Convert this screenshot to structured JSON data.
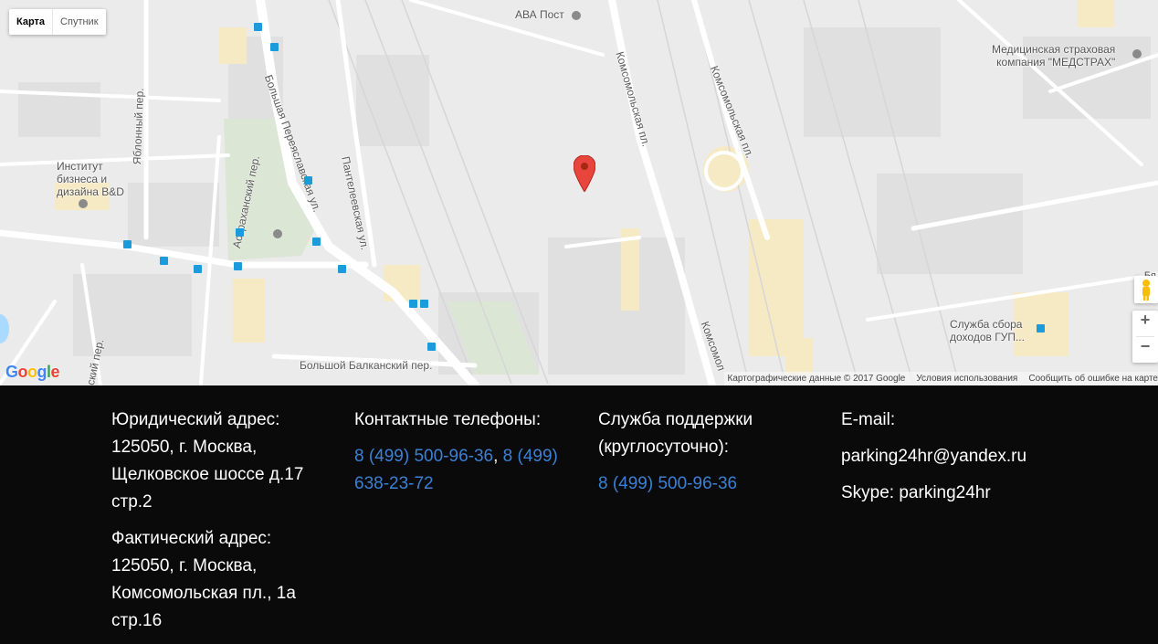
{
  "map": {
    "type_buttons": [
      "Карта",
      "Спутник"
    ],
    "labels": {
      "ava_post": "АВА Пост",
      "medstrakh": "Медицинская страховая\nкомпания \"МЕДСТРАХ\"",
      "institute": "Институт\nбизнеса и\nдизайна B&D",
      "yablonny": "Яблонный пер.",
      "astrakhansky": "Астраханский пер.",
      "bolshaya_pereslavskaya": "Большая Переяславская ул.",
      "panteleevskaya": "Пантелеевская ул.",
      "komsomolskaya1": "Комсомольская пл.",
      "komsomolskaya2": "Комсомольская пл.",
      "komsomol3": "Комсомол",
      "bolshoy_balkansky": "Большой Балканский пер.",
      "sluzhba_sbora": "Служба сбора\nдоходов ГУП...",
      "right_cut": "Бя",
      "left_cut": "ский пер."
    },
    "attribution": {
      "data": "Картографические данные © 2017 Google",
      "terms": "Условия использования",
      "report": "Сообщить об ошибке на карте"
    },
    "google_logo": "Google"
  },
  "footer": {
    "legal": {
      "title": "Юридический адрес:",
      "address": "125050, г. Москва, Щелковское шоссе д.17 стр.2"
    },
    "actual": {
      "title": "Фактический адрес:",
      "address": "125050, г. Москва, Комсомольская пл., 1а стр.16"
    },
    "phones": {
      "title": "Контактные телефоны:",
      "phone1": "8 (499) 500-96-36",
      "separator": ",",
      "phone2": "8 (499) 638-23-72"
    },
    "support": {
      "title": "Служба поддержки (круглосуточно):",
      "phone": "8 (499) 500-96-36"
    },
    "contacts": {
      "email_title": "E-mail:",
      "email": "parking24hr@yandex.ru",
      "skype": "Skype: parking24hr"
    }
  }
}
